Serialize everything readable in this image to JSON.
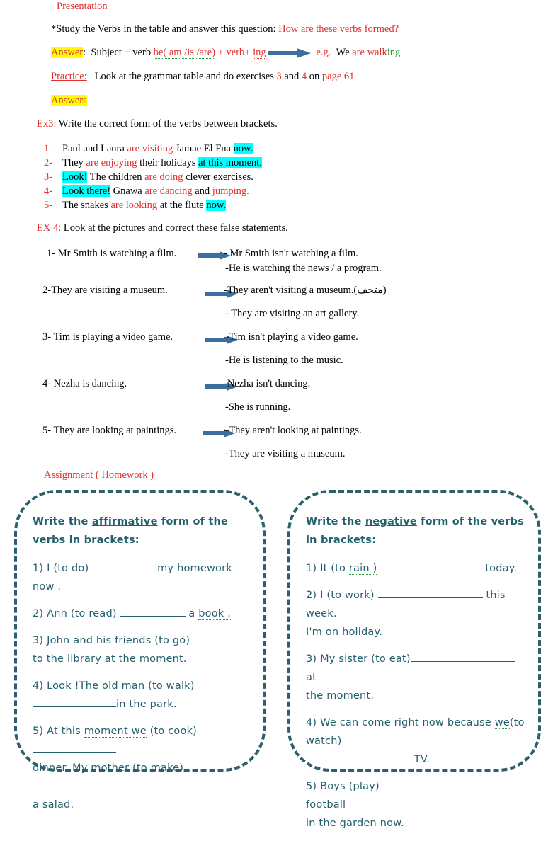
{
  "document": {
    "title": "Presentation",
    "colors": {
      "red": "#E03030",
      "green": "#27A03C",
      "highlight_yellow": "#FFFF00",
      "highlight_cyan": "#00FFFF",
      "arrow_blue": "#3C6E9E",
      "box_teal": "#2E5F6B"
    }
  },
  "presentation": {
    "heading": "Presentation",
    "study_prefix": "*Study the Verbs in the table and answer this question:",
    "study_question": "How are these verbs formed?",
    "answer_label": "Answer",
    "answer_colon": ":",
    "answer_formula_1": "Subject + verb ",
    "answer_formula_be": "be( am /is /are)",
    "answer_formula_plus": " + verb+ ",
    "answer_formula_ing": "ing",
    "eg_label": "e.g.",
    "eg_we": "We ",
    "eg_are_walk": "are walk",
    "eg_ing": "ing",
    "practice_label": "Practice:",
    "practice_text_1": "Look at the grammar table and do exercises ",
    "practice_ex_a": "3",
    "practice_and": " and ",
    "practice_ex_b": "4",
    "practice_text_2": " on ",
    "practice_page": "page 61",
    "answers_label": "Answers"
  },
  "ex3": {
    "label": "Ex3:",
    "instruction": "Write the correct form of the verbs between brackets.",
    "items": [
      {
        "num": "1-",
        "parts": [
          {
            "text": "Paul and Laura ",
            "style": "plain"
          },
          {
            "text": "are visiting",
            "style": "red"
          },
          {
            "text": " Jamae El Fna ",
            "style": "plain"
          },
          {
            "text": "now.",
            "style": "cyan"
          }
        ]
      },
      {
        "num": "2-",
        "parts": [
          {
            "text": "They ",
            "style": "plain"
          },
          {
            "text": "are enjoying",
            "style": "red"
          },
          {
            "text": " their holidays ",
            "style": "plain"
          },
          {
            "text": "at this moment.",
            "style": "cyan"
          }
        ]
      },
      {
        "num": "3-",
        "parts": [
          {
            "text": "Look!",
            "style": "cyan"
          },
          {
            "text": " The children ",
            "style": "plain"
          },
          {
            "text": "are doing",
            "style": "red"
          },
          {
            "text": " clever exercises.",
            "style": "plain"
          }
        ]
      },
      {
        "num": "4-",
        "parts": [
          {
            "text": "Look there!",
            "style": "cyan"
          },
          {
            "text": " Gnawa ",
            "style": "plain"
          },
          {
            "text": "are dancing",
            "style": "red"
          },
          {
            "text": " and ",
            "style": "plain"
          },
          {
            "text": "jumping.",
            "style": "red"
          }
        ]
      },
      {
        "num": "5-",
        "parts": [
          {
            "text": "The snakes ",
            "style": "plain"
          },
          {
            "text": "are looking",
            "style": "red"
          },
          {
            "text": " at the flute ",
            "style": "plain"
          },
          {
            "text": "now.",
            "style": "cyan"
          }
        ]
      }
    ]
  },
  "ex4": {
    "label": "EX 4:",
    "instruction": "Look at the pictures and correct these false statements.",
    "rows": [
      {
        "left": "1-   Mr Smith is watching a film.",
        "right_1": "- Mr Smith isn't watching a film.",
        "right_2": "-He is watching the news / a program."
      },
      {
        "left": "2-They are visiting a museum.",
        "right_1": "-They aren't visiting a museum.(متحف)",
        "right_2": "- They are visiting an art gallery."
      },
      {
        "left": "3- Tim is playing a video game.",
        "right_1": "–Tim isn't playing a video game.",
        "right_2": "-He is listening to the music."
      },
      {
        "left": "4- Nezha is dancing.",
        "right_1": "-Nezha isn't dancing.",
        "right_2": "-She is running."
      },
      {
        "left": "5- They are looking at paintings.",
        "right_1": "–They aren't looking at paintings.",
        "right_2": "-They are visiting a museum."
      }
    ]
  },
  "assignment": {
    "heading": "Assignment ( Homework )",
    "left_box": {
      "head_a": "Write the ",
      "head_b": "affirmative",
      "head_c": " form of the verbs in brackets:",
      "items": [
        {
          "a": "1) I (to do) ",
          "blank": "b-md",
          "b": "my homework ",
          "c": "now ."
        },
        {
          "a": "2) Ann (to read) ",
          "blank": "b-md",
          "b": " a ",
          "c": "book ."
        },
        {
          "a": "3) John and his friends (to go) ",
          "blank": "b-sm",
          "b": "",
          "c": "to the library at the moment."
        },
        {
          "a": "4) Look !The",
          "blank": "b-lg",
          "b": " old man (to walk)",
          "c": "in the park."
        },
        {
          "a": "5) At this ",
          "blank": "b-lg",
          "b": "moment we",
          "c": " (to cook) ",
          "d": "dinner. My mother (to make)",
          "e": "a salad."
        }
      ]
    },
    "right_box": {
      "head_a": "Write the ",
      "head_b": "negative",
      "head_c": " form of the verbs in brackets:",
      "items": [
        {
          "a": "1) It (to ",
          "sq": "rain )",
          "b": " ",
          "blank": "b-xl",
          "c": "today."
        },
        {
          "a": "2) I (to work) ",
          "blank": "b-xl",
          "b": " this week.",
          "c": "I'm on holiday."
        },
        {
          "a": "3) My sister (to eat)",
          "blank": "b-xl",
          "b": " at",
          "c": "the moment."
        },
        {
          "a": "4) We can come right now because ",
          "sq": "we",
          "b": "(to watch)",
          "blank": "b-xl",
          "c": " TV."
        },
        {
          "a": "5) Boys (play) ",
          "blank": "b-xl",
          "b": " football",
          "c": "in the garden now."
        }
      ]
    }
  }
}
